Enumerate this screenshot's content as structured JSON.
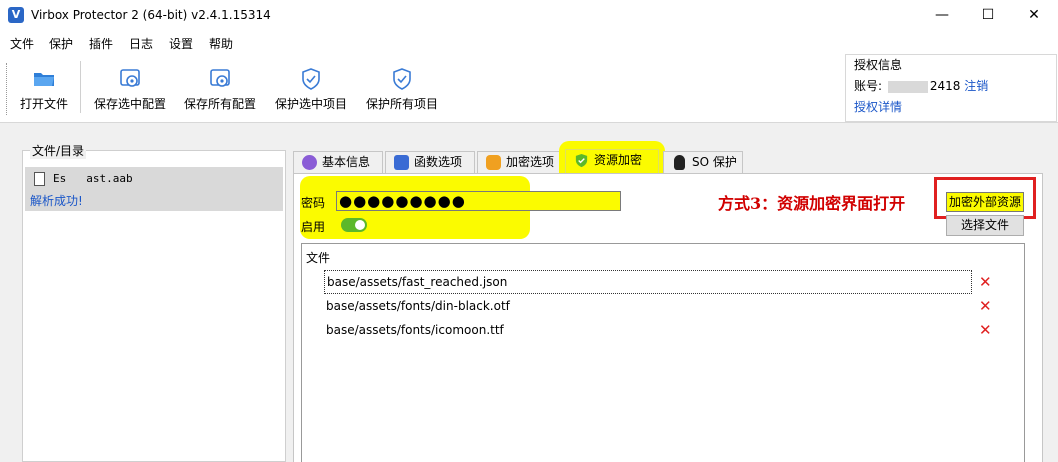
{
  "window": {
    "title": "Virbox Protector 2 (64-bit) v2.4.1.15314",
    "icon_letter": "V",
    "controls": [
      "—",
      "☐",
      "✕"
    ]
  },
  "menu": [
    "文件",
    "保护",
    "插件",
    "日志",
    "设置",
    "帮助"
  ],
  "toolbar": {
    "open_file": "打开文件",
    "save_selected_config": "保存选中配置",
    "save_all_config": "保存所有配置",
    "protect_selected": "保护选中项目",
    "protect_all": "保护所有项目"
  },
  "auth": {
    "title": "授权信息",
    "account_label": "账号:",
    "account_suffix": "2418",
    "logout": "注销",
    "details": "授权详情"
  },
  "left_panel": {
    "title": "文件/目录",
    "file_name_start": "Es",
    "file_name_end": "ast.aab",
    "status": "解析成功!"
  },
  "tabs": [
    {
      "label": "基本信息",
      "icon": "chat-bubble-icon",
      "color": "#8a5cd6"
    },
    {
      "label": "函数选项",
      "icon": "function-icon",
      "color": "#3a6bd4"
    },
    {
      "label": "加密选项",
      "icon": "lock-icon",
      "color": "#f0a020"
    },
    {
      "label": "资源加密",
      "icon": "shield-check-icon",
      "color": "#5cb82a"
    },
    {
      "label": "SO 保护",
      "icon": "linux-penguin-icon",
      "color": "#222222"
    }
  ],
  "resource": {
    "password_label": "密码",
    "password_value": "●●●●●●●●●",
    "enable_label": "启用",
    "enabled": true,
    "annotation": "方式3：资源加密界面打开",
    "encrypt_external_button": "加密外部资源",
    "select_file_button": "选择文件",
    "list_header": "文件",
    "files": [
      "base/assets/fast_reached.json",
      "base/assets/fonts/din-black.otf",
      "base/assets/fonts/icomoon.ttf"
    ],
    "delete_glyph": "✕"
  },
  "colors": {
    "highlight": "#fbfb00",
    "annotation_red": "#d10000",
    "link_blue": "#1a56c8",
    "toggle_green": "#5cb82a"
  }
}
